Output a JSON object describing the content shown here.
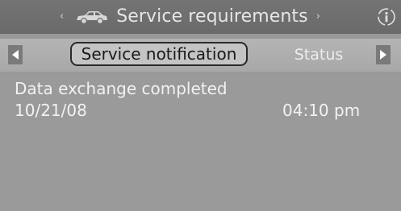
{
  "header": {
    "title": "Service requirements",
    "prev_icon": "chevron-left-icon",
    "next_icon": "chevron-right-icon",
    "vehicle_icon": "car-icon",
    "info_icon": "info-icon"
  },
  "tabs": [
    {
      "label": "Service notification",
      "selected": true
    },
    {
      "label": "Status",
      "selected": false
    }
  ],
  "tab_nav": {
    "left_icon": "triangle-left-icon",
    "right_icon": "triangle-right-icon"
  },
  "notification": {
    "message": "Data exchange completed",
    "date": "10/21/08",
    "time": "04:10 pm"
  },
  "colors": {
    "screen_background": "#999999",
    "title_bar": "#6f6f6f",
    "tab_row": "#adadad",
    "active_tab_border": "#2a2a2a",
    "text_light": "#f2f2f2"
  }
}
